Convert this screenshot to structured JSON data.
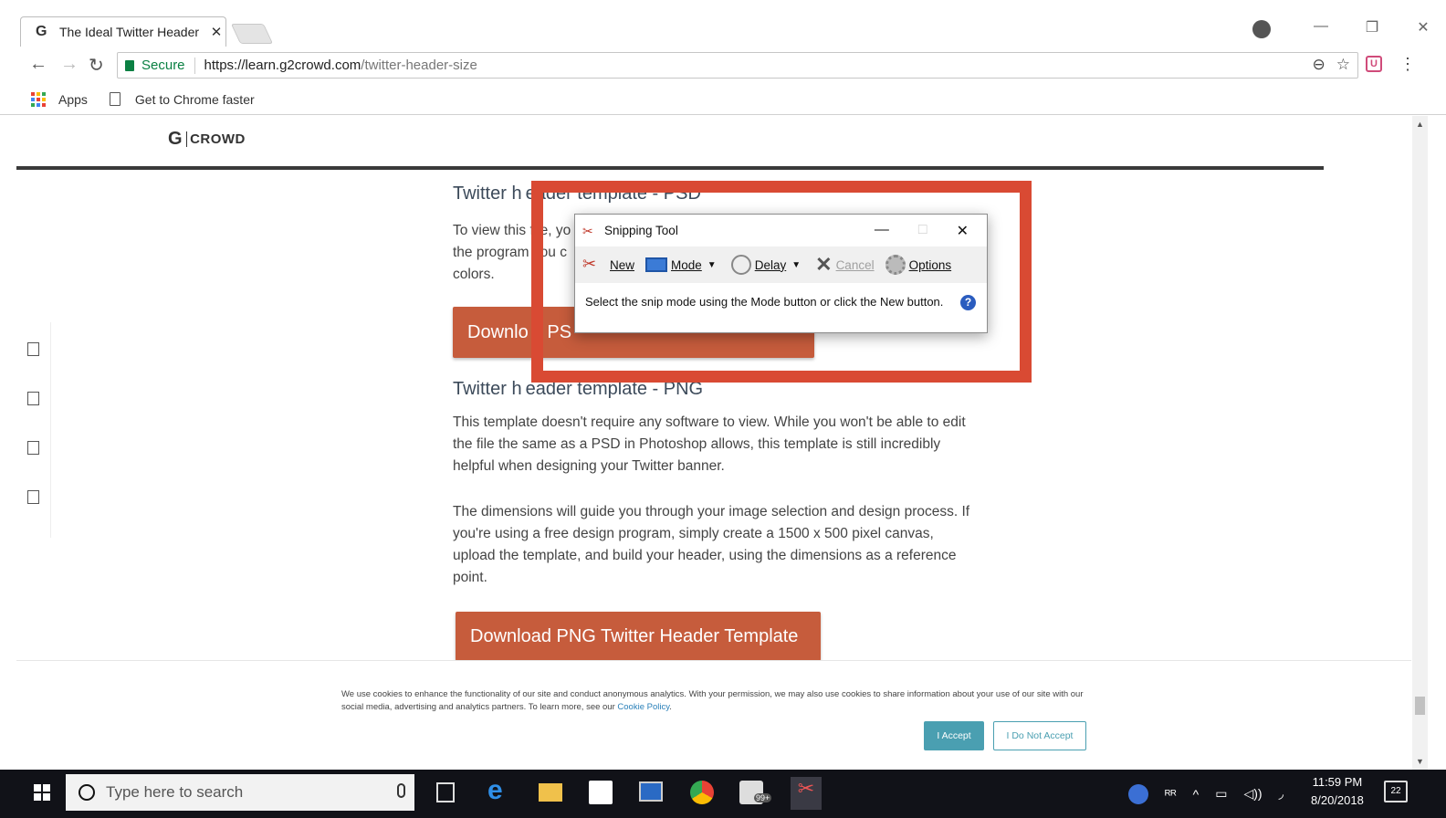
{
  "browser": {
    "tab_title": "The Ideal Twitter Header",
    "tab_close": "✕",
    "favicon": "G",
    "secure_label": "Secure",
    "url_host": "https://learn.g2crowd.com",
    "url_path": "/twitter-header-size",
    "bookmarks": {
      "apps": "Apps",
      "get_chrome": "Get to Chrome faster"
    },
    "icons": [
      "back-arrow-icon",
      "forward-arrow-icon",
      "reload-icon",
      "zoom-icon",
      "star-icon",
      "menu-dots-icon"
    ]
  },
  "site": {
    "logo_text": "CROWD",
    "logo_g": "G"
  },
  "content": {
    "psd_heading": "Twitter header template - PSD",
    "psd_para": "To view this file, you'll need the program you can use to edit colors.",
    "psd_para_visible": [
      "To view this",
      "file, yo",
      "the program",
      "you c",
      "colors."
    ],
    "psd_button_left": "Downlo",
    "psd_button_right": "d PS",
    "png_heading_left": "Twitter h",
    "png_heading_right": "eader template - PNG",
    "psd_heading_left": "Twitter h",
    "psd_heading_right": "eader template - PSD",
    "png_para1": "This template doesn't require any software to view. While you won't be able to edit the file the same as a PSD in Photoshop allows, this template is still incredibly helpful when designing your Twitter banner.",
    "png_para2": "The dimensions will guide you through your image selection and design process. If you're using a free design program, simply create a 1500 x 500 pixel canvas, upload the template, and build your header, using the dimensions as a reference point.",
    "png_button": "Download PNG Twitter Header Template"
  },
  "snipping_tool": {
    "title": "Snipping Tool",
    "new": "New",
    "mode": "Mode",
    "delay": "Delay",
    "cancel": "Cancel",
    "options": "Options",
    "message": "Select the snip mode using the Mode button or click the New button.",
    "help": "?"
  },
  "cookie": {
    "text": "We use cookies to enhance the functionality of our site and conduct anonymous analytics. With your permission, we may also use cookies to share information about your use of our site with our social media, advertising and analytics partners. To learn more, see our ",
    "link": "Cookie Policy",
    "end": ".",
    "accept": "I Accept",
    "decline": "I Do Not Accept"
  },
  "taskbar": {
    "search_placeholder": "Type here to search",
    "badge": "99+",
    "time": "11:59 PM",
    "date": "8/20/2018",
    "notifications": "22"
  },
  "colors": {
    "accent_button": "#c65c3c",
    "highlight_box": "#d94a33",
    "cookie_accept": "#4a9fb1",
    "secure_green": "#0b8043"
  }
}
